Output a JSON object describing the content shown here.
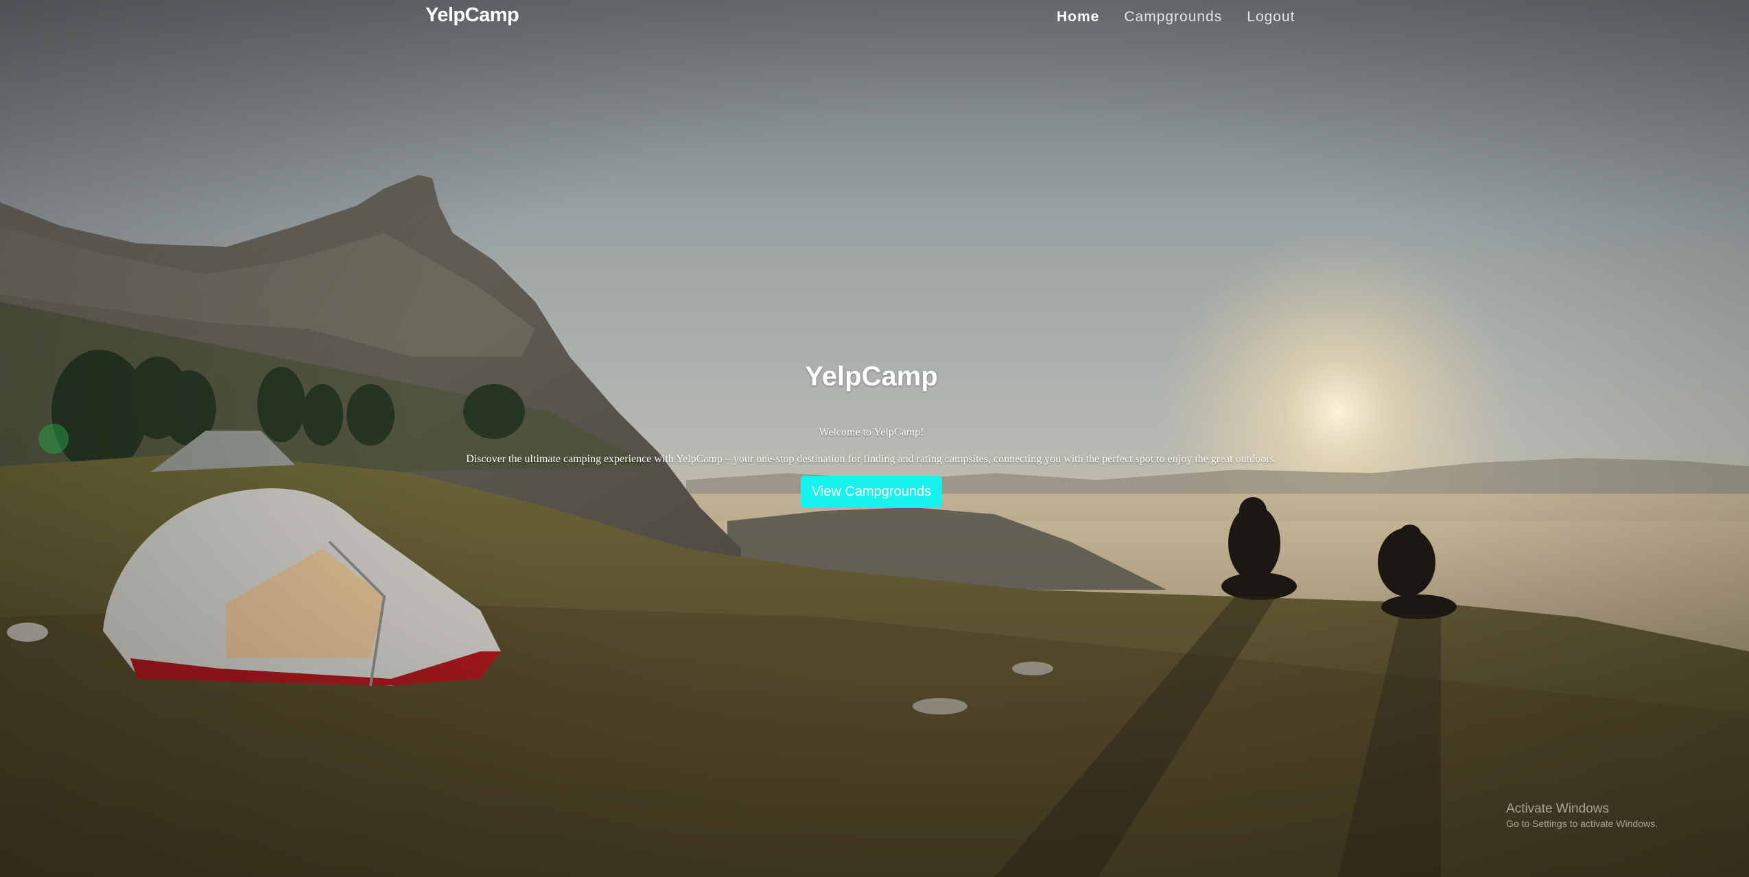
{
  "navbar": {
    "brand": "YelpCamp",
    "links": [
      {
        "label": "Home"
      },
      {
        "label": "Campgrounds"
      },
      {
        "label": "Logout"
      }
    ]
  },
  "hero": {
    "title": "YelpCamp",
    "welcome": "Welcome to YelpCamp!",
    "description": "Discover the ultimate camping experience with YelpCamp – your one-stop destination for finding and rating campsites, connecting you with the perfect spot to enjoy the great outdoors.",
    "button_label": "View Campgrounds"
  },
  "watermark": {
    "title": "Activate Windows",
    "subtitle": "Go to Settings to activate Windows."
  },
  "colors": {
    "accent_button": "#17f2f0",
    "text": "#ffffff"
  }
}
